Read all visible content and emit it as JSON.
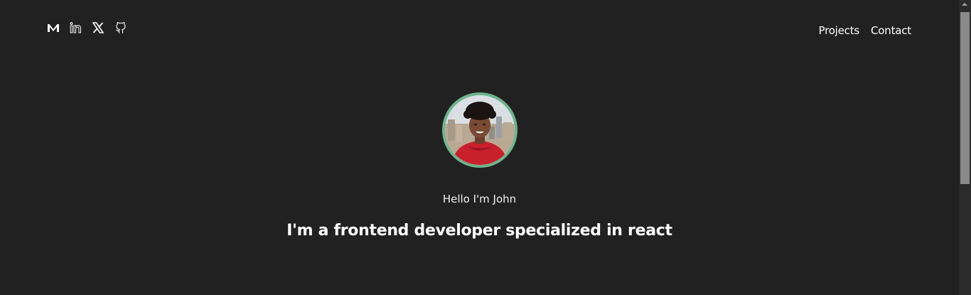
{
  "socials": [
    {
      "name": "medium",
      "icon": "medium-icon"
    },
    {
      "name": "linkedin",
      "icon": "linkedin-icon"
    },
    {
      "name": "x",
      "icon": "x-icon"
    },
    {
      "name": "github",
      "icon": "github-icon"
    }
  ],
  "nav": {
    "projects": "Projects",
    "contact": "Contact"
  },
  "hero": {
    "avatar_ring_color": "#6db38b",
    "greeting": "Hello I'm John",
    "headline": "I'm a frontend developer specialized in react"
  },
  "colors": {
    "background": "#212121",
    "text": "#ffffff"
  }
}
